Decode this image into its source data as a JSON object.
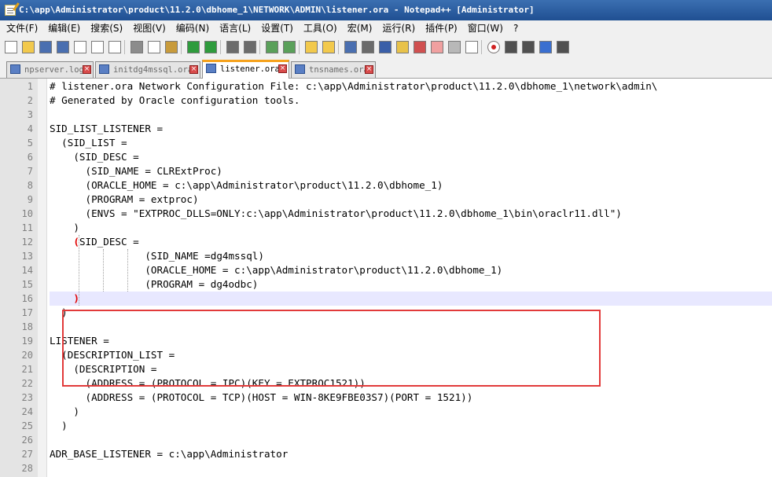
{
  "window": {
    "title": "C:\\app\\Administrator\\product\\11.2.0\\dbhome_1\\NETWORK\\ADMIN\\listener.ora - Notepad++ [Administrator]"
  },
  "menu": [
    "文件(F)",
    "编辑(E)",
    "搜索(S)",
    "视图(V)",
    "编码(N)",
    "语言(L)",
    "设置(T)",
    "工具(O)",
    "宏(M)",
    "运行(R)",
    "插件(P)",
    "窗口(W)",
    "?"
  ],
  "toolbar_icons": [
    "new-file-icon",
    "open-file-icon",
    "save-icon",
    "save-all-icon",
    "close-icon",
    "close-all-icon",
    "print-icon",
    "cut-icon",
    "copy-icon",
    "paste-icon",
    "undo-icon",
    "redo-icon",
    "find-icon",
    "replace-icon",
    "zoom-in-icon",
    "zoom-out-icon",
    "sync-vertical-icon",
    "sync-horizontal-icon",
    "word-wrap-icon",
    "show-all-chars-icon",
    "indent-guide-icon",
    "user-language-icon",
    "doc-map-icon",
    "function-list-icon",
    "folder-workspace-icon",
    "monitor-icon",
    "record-macro-icon",
    "stop-macro-icon",
    "play-macro-icon",
    "run-macro-multiple-icon",
    "save-macro-icon"
  ],
  "tabs": [
    {
      "label": "npserver.log",
      "active": false
    },
    {
      "label": "initdg4mssql.ora",
      "active": false
    },
    {
      "label": "listener.ora",
      "active": true
    },
    {
      "label": "tnsnames.ora",
      "active": false
    }
  ],
  "editor": {
    "current_line": 16,
    "lines": [
      "# listener.ora Network Configuration File: c:\\app\\Administrator\\product\\11.2.0\\dbhome_1\\network\\admin\\",
      "# Generated by Oracle configuration tools.",
      "",
      "SID_LIST_LISTENER =",
      "  (SID_LIST =",
      "    (SID_DESC =",
      "      (SID_NAME = CLRExtProc)",
      "      (ORACLE_HOME = c:\\app\\Administrator\\product\\11.2.0\\dbhome_1)",
      "      (PROGRAM = extproc)",
      "      (ENVS = \"EXTPROC_DLLS=ONLY:c:\\app\\Administrator\\product\\11.2.0\\dbhome_1\\bin\\oraclr11.dll\")",
      "    )",
      "    (SID_DESC =",
      "\t\t(SID_NAME =dg4mssql)",
      "\t\t(ORACLE_HOME = c:\\app\\Administrator\\product\\11.2.0\\dbhome_1)",
      "\t\t(PROGRAM = dg4odbc)",
      "    )",
      "  )",
      "",
      "LISTENER =",
      "  (DESCRIPTION_LIST =",
      "    (DESCRIPTION =",
      "      (ADDRESS = (PROTOCOL = IPC)(KEY = EXTPROC1521))",
      "      (ADDRESS = (PROTOCOL = TCP)(HOST = WIN-8KE9FBE03S7)(PORT = 1521))",
      "    )",
      "  )",
      "",
      "ADR_BASE_LISTENER = c:\\app\\Administrator",
      ""
    ]
  },
  "colors": {
    "titlebar": "#1f4f92",
    "current_line": "#e8e8ff",
    "highlight_box": "#e23a3a",
    "brace_match": "#e00000",
    "active_tab_accent": "#f6a21c"
  }
}
